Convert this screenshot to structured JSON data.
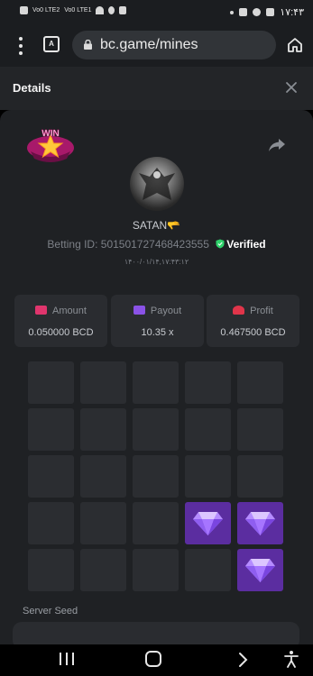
{
  "statusbar": {
    "left_text": [
      "Vo0 LTE2",
      "Vo0 LTE1"
    ],
    "time": "۱۷:۴۳"
  },
  "browser": {
    "url": "bc.game/mines",
    "tabs_label": "A"
  },
  "details": {
    "title": "Details"
  },
  "bet": {
    "win_badge_text": "WIN",
    "username": "SATAN🫳",
    "betting_id_label": "Betting ID:",
    "betting_id": "501501727468423555",
    "verified_label": "Verified",
    "timestamp": "۱۴۰۰/۰۱/۱۴,۱۷:۴۳:۱۲"
  },
  "stats": {
    "amount": {
      "label": "Amount",
      "value": "0.050000 BCD",
      "icon": "coins-icon",
      "color": "#e0356d"
    },
    "payout": {
      "label": "Payout",
      "value": "10.35 x",
      "icon": "card-icon",
      "color": "#8a52e6"
    },
    "profit": {
      "label": "Profit",
      "value": "0.467500 BCD",
      "icon": "cash-icon",
      "color": "#e0354a"
    }
  },
  "mines_grid": {
    "rows": 5,
    "cols": 5,
    "gem_cells": [
      [
        3,
        3
      ],
      [
        3,
        4
      ],
      [
        4,
        4
      ]
    ]
  },
  "seed": {
    "server_seed_label": "Server Seed"
  },
  "colors": {
    "accent_gem": "#5b2da0",
    "verified_green": "#2fd26b",
    "tile": "#2b2d31"
  }
}
